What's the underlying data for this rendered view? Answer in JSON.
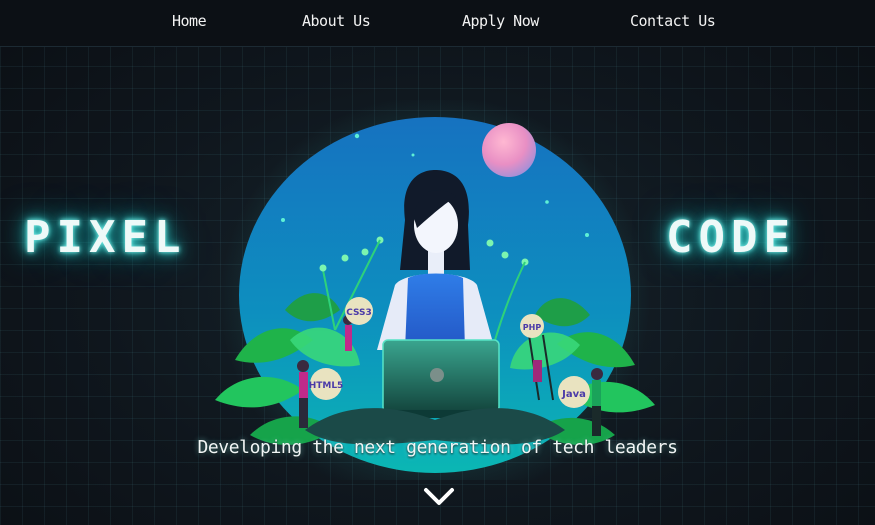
{
  "nav": {
    "items": [
      {
        "label": "Home"
      },
      {
        "label": "About Us"
      },
      {
        "label": "Apply Now"
      },
      {
        "label": "Contact Us"
      }
    ]
  },
  "hero": {
    "brand_left": "PIXEL",
    "brand_right": "CODE",
    "tagline": "Developing the next generation of tech leaders",
    "badges": {
      "css": "CSS3",
      "php": "PHP",
      "html": "HTML5",
      "java": "Java"
    }
  },
  "icons": {
    "scroll": "chevron-down-icon"
  },
  "colors": {
    "background": "#10141a",
    "navbar": "#0c1015",
    "glow": "#37d9d3",
    "circle_top": "#1486c2",
    "circle_bottom": "#0ba6b6",
    "leaf_green": "#22c55e"
  }
}
